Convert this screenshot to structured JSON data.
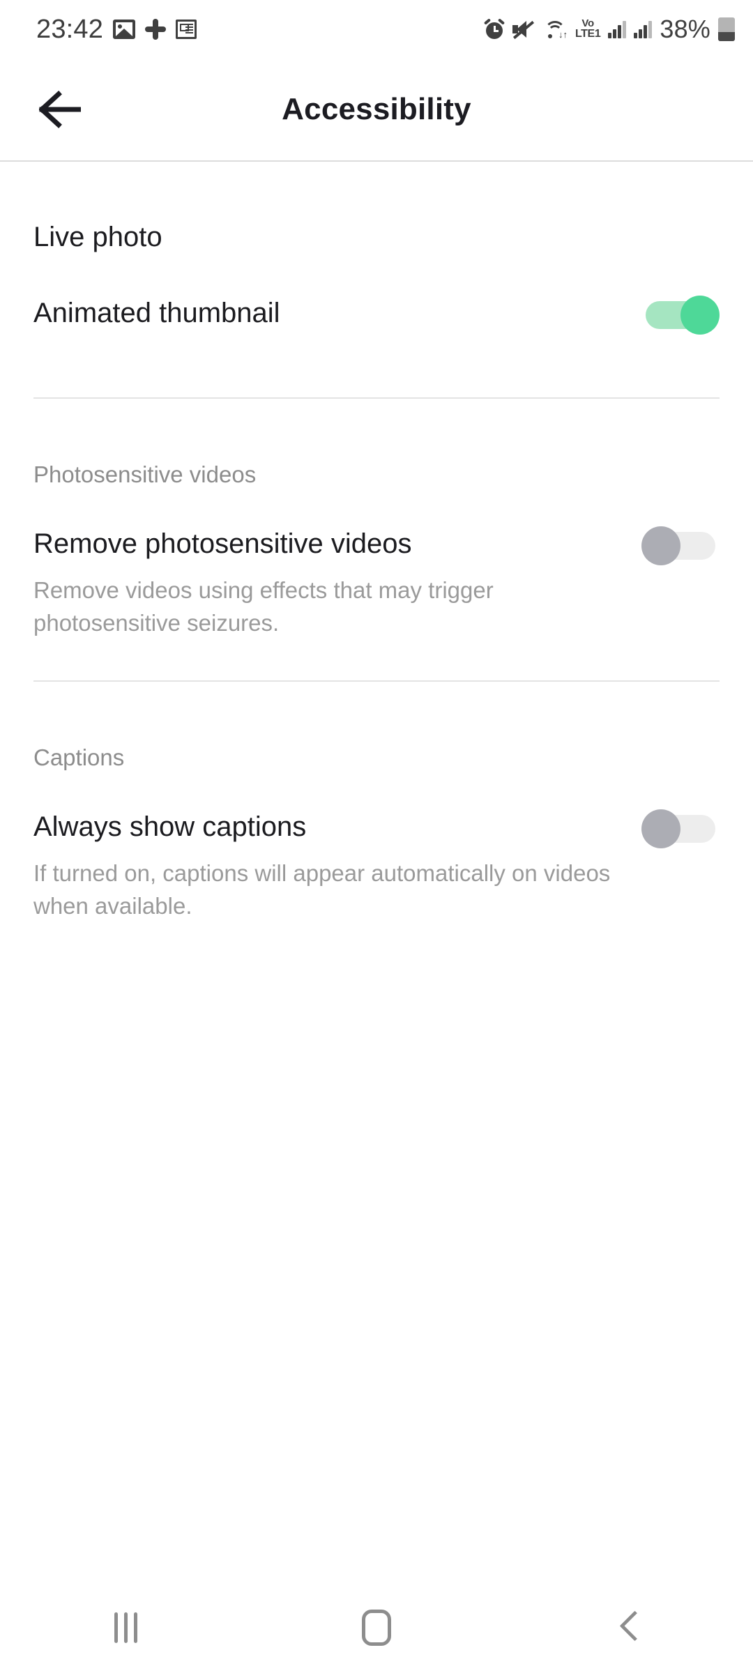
{
  "status_bar": {
    "time": "23:42",
    "left_icons": [
      "photo-icon",
      "slack-icon",
      "news-icon"
    ],
    "right_icons": [
      "alarm-icon",
      "mute-icon",
      "wifi-icon"
    ],
    "network_label_top": "Vo",
    "network_label_bottom": "LTE1",
    "battery_percent": "38%",
    "battery_level": 38
  },
  "app_bar": {
    "title": "Accessibility",
    "back_icon": "arrow-left-icon"
  },
  "sections": [
    {
      "id": "live-photo",
      "heading": "Live photo",
      "heading_style": "group",
      "rows": [
        {
          "id": "animated-thumbnail",
          "title": "Animated thumbnail",
          "description": "",
          "toggle": "on"
        }
      ]
    },
    {
      "id": "photosensitive-videos",
      "heading": "Photosensitive videos",
      "heading_style": "label",
      "rows": [
        {
          "id": "remove-photosensitive-videos",
          "title": "Remove photosensitive videos",
          "description": "Remove videos using effects that may trigger photosensitive seizures.",
          "toggle": "off"
        }
      ]
    },
    {
      "id": "captions",
      "heading": "Captions",
      "heading_style": "label",
      "rows": [
        {
          "id": "always-show-captions",
          "title": "Always show captions",
          "description": "If turned on, captions will appear automatically on videos when available.",
          "toggle": "off"
        }
      ]
    }
  ],
  "nav_bar": {
    "recents_icon": "recents-icon",
    "home_icon": "home-icon",
    "back_icon": "back-chevron-icon"
  },
  "colors": {
    "toggle_on_track": "#a5e5c1",
    "toggle_on_thumb": "#4ed898",
    "toggle_off_track": "#ededed",
    "toggle_off_thumb": "#acadb4",
    "title_text": "#1b1b1f",
    "muted_text": "#9a9a9a",
    "divider": "#e3e3e3"
  }
}
